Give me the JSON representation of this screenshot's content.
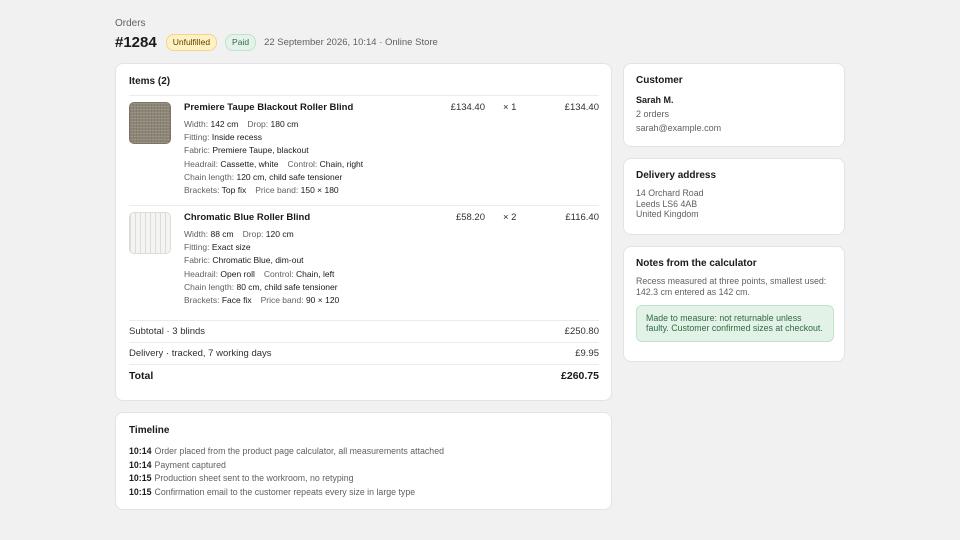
{
  "breadcrumb": "Orders",
  "header": {
    "order_number": "#1284",
    "badge_unfulfilled": "Unfulfilled",
    "badge_paid": "Paid",
    "meta": "22 September 2026, 10:14 · Online Store"
  },
  "items_card": {
    "title": "Items (2)",
    "items": [
      {
        "name": "Premiere Taupe Blackout Roller Blind",
        "price": "£134.40",
        "qty": "× 1",
        "total": "£134.40",
        "thumb_color": "#8d8677",
        "specs": [
          [
            {
              "label": "Width:",
              "value": "142 cm"
            },
            {
              "label": "Drop:",
              "value": "180 cm"
            }
          ],
          [
            {
              "label": "Fitting:",
              "value": "Inside recess"
            }
          ],
          [
            {
              "label": "Fabric:",
              "value": "Premiere Taupe, blackout"
            }
          ],
          [
            {
              "label": "Headrail:",
              "value": "Cassette, white"
            },
            {
              "label": "Control:",
              "value": "Chain, right"
            }
          ],
          [
            {
              "label": "Chain length:",
              "value": "120 cm, child safe tensioner"
            }
          ],
          [
            {
              "label": "Brackets:",
              "value": "Top fix"
            },
            {
              "label": "Price band:",
              "value": "150 × 180"
            }
          ]
        ]
      },
      {
        "name": "Chromatic Blue Roller Blind",
        "price": "£58.20",
        "qty": "× 2",
        "total": "£116.40",
        "thumb_color": "#f4f5f2",
        "specs": [
          [
            {
              "label": "Width:",
              "value": "88 cm"
            },
            {
              "label": "Drop:",
              "value": "120 cm"
            }
          ],
          [
            {
              "label": "Fitting:",
              "value": "Exact size"
            }
          ],
          [
            {
              "label": "Fabric:",
              "value": "Chromatic Blue, dim-out"
            }
          ],
          [
            {
              "label": "Headrail:",
              "value": "Open roll"
            },
            {
              "label": "Control:",
              "value": "Chain, left"
            }
          ],
          [
            {
              "label": "Chain length:",
              "value": "80 cm, child safe tensioner"
            }
          ],
          [
            {
              "label": "Brackets:",
              "value": "Face fix"
            },
            {
              "label": "Price band:",
              "value": "90 × 120"
            }
          ]
        ]
      }
    ],
    "subtotal": {
      "label": "Subtotal · 3 blinds",
      "value": "£250.80"
    },
    "delivery": {
      "label": "Delivery · tracked, 7 working days",
      "value": "£9.95"
    },
    "total": {
      "label": "Total",
      "value": "£260.75"
    }
  },
  "timeline": {
    "title": "Timeline",
    "events": [
      {
        "time": "10:14",
        "text": "Order placed from the product page calculator, all measurements attached"
      },
      {
        "time": "10:14",
        "text": "Payment captured"
      },
      {
        "time": "10:15",
        "text": "Production sheet sent to the workroom, no retyping"
      },
      {
        "time": "10:15",
        "text": "Confirmation email to the customer repeats every size in large type"
      }
    ]
  },
  "customer": {
    "title": "Customer",
    "name": "Sarah M.",
    "orders": "2 orders",
    "email": "sarah@example.com"
  },
  "delivery_address": {
    "title": "Delivery address",
    "lines": [
      "14 Orchard Road",
      "Leeds LS6 4AB",
      "United Kingdom"
    ]
  },
  "notes": {
    "title": "Notes from the calculator",
    "text": "Recess measured at three points, smallest used: 142.3 cm entered as 142 cm.",
    "callout": "Made to measure: not returnable unless faulty. Customer confirmed sizes at checkout."
  },
  "colors": {
    "background": "#f1f1f1",
    "badge_unfulfilled_bg": "#fff1c2",
    "badge_paid_bg": "#e4f3ea",
    "callout_bg": "#e2f2e7",
    "callout_text": "#2e6b41"
  }
}
